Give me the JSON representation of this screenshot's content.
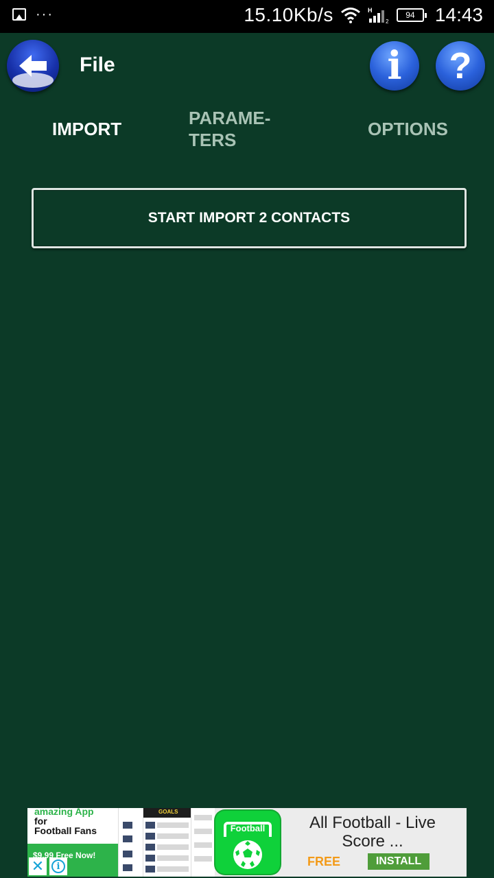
{
  "status_bar": {
    "net_speed": "15.10Kb/s",
    "network_type": "H",
    "sim_slot": "2",
    "battery": "94",
    "time": "14:43",
    "more": "···",
    "icons": [
      "gallery-icon",
      "wifi-icon",
      "signal-icon",
      "battery-icon"
    ]
  },
  "app_bar": {
    "title": "File",
    "info_glyph": "i",
    "help_glyph": "?",
    "icons": [
      "back-arrow-icon",
      "info-icon",
      "help-icon"
    ]
  },
  "tabs": [
    {
      "label": "IMPORT",
      "selected": true
    },
    {
      "label": "PARAME-\nTERS",
      "selected": false
    },
    {
      "label": "OPTIONS",
      "selected": false
    }
  ],
  "main": {
    "start_button_label": "START IMPORT 2 CONTACTS"
  },
  "ad": {
    "tagline_line1": "amazing App",
    "tagline_line2": "for",
    "tagline_line3": "Football Fans",
    "price_text": "$9.99 Free Now!",
    "close_glyph": "✕",
    "info_glyph": "i",
    "icon_label": "Football",
    "screens_headline": "GOALS",
    "app_title": "All Football - Live Score ...",
    "free_label": "FREE",
    "install_label": "INSTALL"
  },
  "colors": {
    "background": "#0c3a27",
    "status_bar": "#000000",
    "tab_active": "#ffffff",
    "tab_inactive": "#a9c3b5",
    "ad_green": "#2db34a",
    "ad_install": "#4f9d3a",
    "ad_free": "#f39a18"
  }
}
